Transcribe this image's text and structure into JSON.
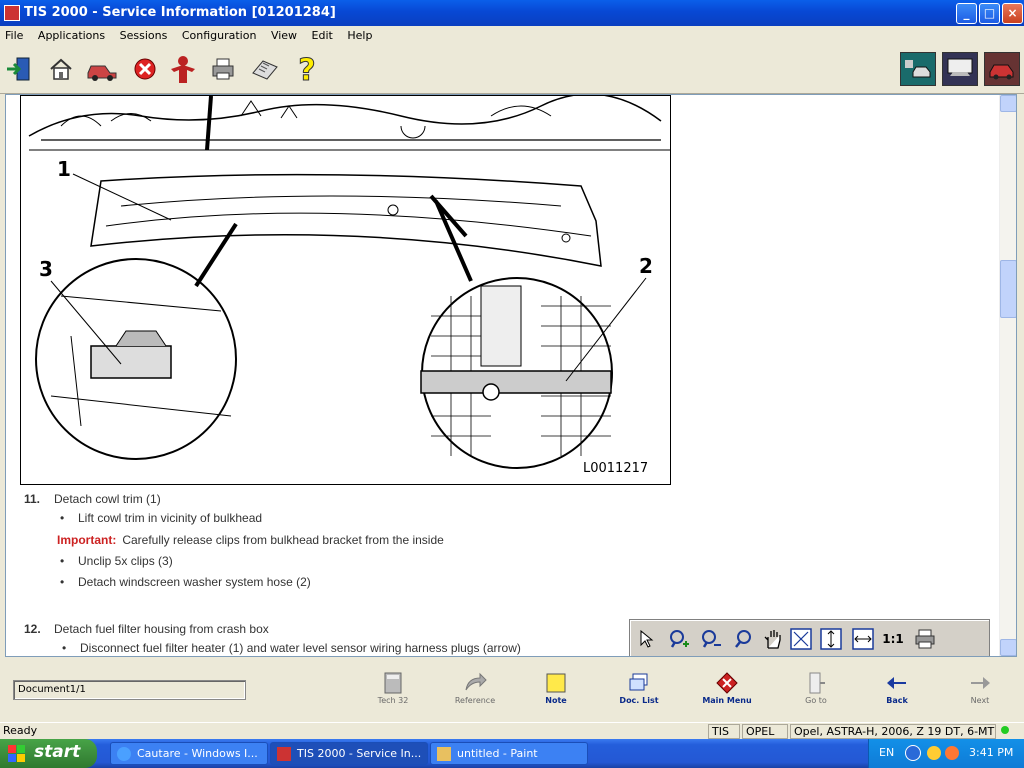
{
  "window": {
    "title": "TIS 2000 - Service Information [01201284]"
  },
  "menu": [
    "File",
    "Applications",
    "Sessions",
    "Configuration",
    "View",
    "Edit",
    "Help"
  ],
  "diagram": {
    "callouts": [
      "1",
      "2",
      "3"
    ],
    "figure_id": "L0011217"
  },
  "steps": [
    {
      "number": "11.",
      "text": "Detach cowl trim (1)",
      "bullets": [
        "Lift cowl trim in vicinity of bulkhead",
        "Unclip 5x clips (3)",
        "Detach windscreen washer system hose (2)"
      ],
      "important_label": "Important:",
      "important_text": "Carefully release clips from bulkhead bracket from the inside"
    },
    {
      "number": "12.",
      "text": "Detach fuel filter housing from crash box",
      "bullets": [
        "Disconnect fuel filter heater (1) and water level sensor wiring harness plugs (arrow)"
      ]
    }
  ],
  "zoombar": {
    "one_to_one": "1:1"
  },
  "nav": {
    "document_field": "Document1/1",
    "buttons": [
      "Tech 32",
      "Reference",
      "Note",
      "Doc. List",
      "Main Menu",
      "Go to",
      "Back",
      "Next"
    ]
  },
  "status": {
    "ready": "Ready",
    "app": "TIS",
    "make": "OPEL",
    "vehicle": "Opel, ASTRA-H, 2006, Z 19 DT, 6-MT"
  },
  "taskbar": {
    "start": "start",
    "tasks": [
      "Cautare - Windows I...",
      "TIS 2000 - Service In...",
      "untitled - Paint"
    ],
    "lang": "EN",
    "clock": "3:41 PM"
  },
  "colors": {
    "important": "#CC2222",
    "titlebar": "#0A5FEA",
    "taskbar": "#245EDB"
  }
}
